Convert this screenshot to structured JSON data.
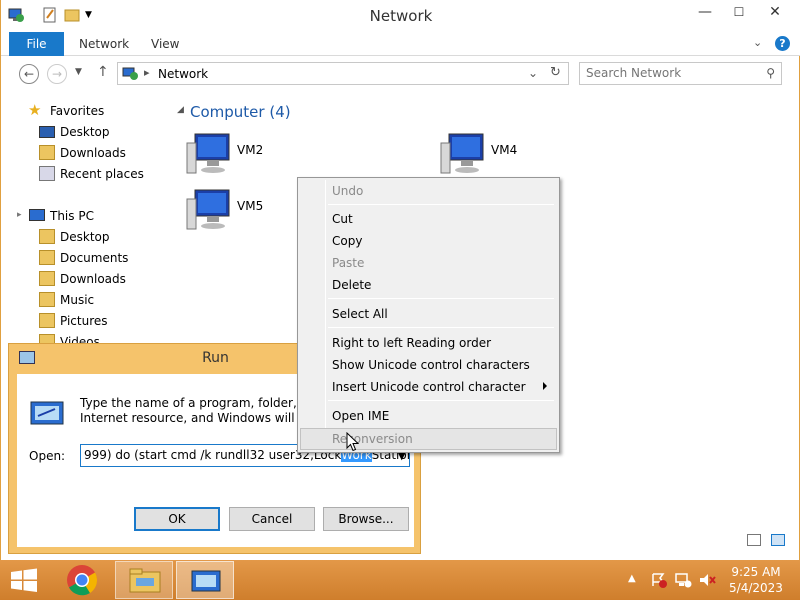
{
  "window": {
    "title": "Network"
  },
  "ribbon": {
    "tabs": {
      "file": "File",
      "network": "Network",
      "view": "View"
    },
    "help": "?"
  },
  "window_controls": {
    "minimize": "—",
    "maximize": "☐",
    "close": "✕"
  },
  "address": {
    "path": "Network"
  },
  "search": {
    "placeholder": "Search Network"
  },
  "nav_pane": {
    "favorites": "Favorites",
    "favorites_items": [
      "Desktop",
      "Downloads",
      "Recent places"
    ],
    "this_pc": "This PC",
    "this_pc_items": [
      "Desktop",
      "Documents",
      "Downloads",
      "Music",
      "Pictures",
      "Videos"
    ]
  },
  "content": {
    "group_header": "Computer (4)",
    "computers": [
      "VM2",
      "VM4",
      "VM5"
    ]
  },
  "context_menu": {
    "items": [
      "Undo",
      "Cut",
      "Copy",
      "Paste",
      "Delete",
      "Select All",
      "Right to left Reading order",
      "Show Unicode control characters",
      "Insert Unicode control character",
      "Open IME",
      "Reconversion"
    ]
  },
  "run_dialog": {
    "title": "Run",
    "description": "Type the name of a program, folder, document, or Internet resource, and Windows will open it for you.",
    "open_label": "Open:",
    "open_value_before": "999) do (start cmd /k rundll32 user32,Lock",
    "open_value_selected": "Work",
    "open_value_after": "Station)",
    "ok": "OK",
    "cancel": "Cancel",
    "browse": "Browse..."
  },
  "taskbar": {
    "time": "9:25 AM",
    "date": "5/4/2023"
  },
  "colors": {
    "accent": "#1979ca",
    "taskbar": "#d98a3a",
    "run_frame": "#f5c36b"
  }
}
